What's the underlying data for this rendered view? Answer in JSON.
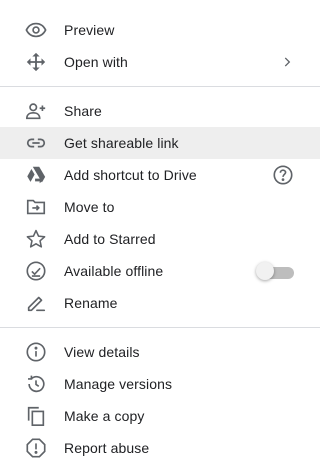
{
  "menu": {
    "group1": [
      {
        "label": "Preview",
        "icon": "eye-icon"
      },
      {
        "label": "Open with",
        "icon": "move-arrows-icon",
        "trailing": "chevron-right"
      }
    ],
    "group2": [
      {
        "label": "Share",
        "icon": "person-add-icon"
      },
      {
        "label": "Get shareable link",
        "icon": "link-icon",
        "highlighted": true
      },
      {
        "label": "Add shortcut to Drive",
        "icon": "drive-shortcut-icon",
        "trailing": "help"
      },
      {
        "label": "Move to",
        "icon": "folder-move-icon"
      },
      {
        "label": "Add to Starred",
        "icon": "star-icon"
      },
      {
        "label": "Available offline",
        "icon": "offline-check-icon",
        "trailing": "toggle",
        "toggle_on": false
      },
      {
        "label": "Rename",
        "icon": "pencil-icon"
      }
    ],
    "group3": [
      {
        "label": "View details",
        "icon": "info-icon"
      },
      {
        "label": "Manage versions",
        "icon": "history-icon"
      },
      {
        "label": "Make a copy",
        "icon": "copy-icon"
      },
      {
        "label": "Report abuse",
        "icon": "report-icon"
      }
    ]
  },
  "colors": {
    "icon": "#5f6368",
    "text": "#202124",
    "highlight": "#eeeeee",
    "divider": "#dadce0"
  }
}
